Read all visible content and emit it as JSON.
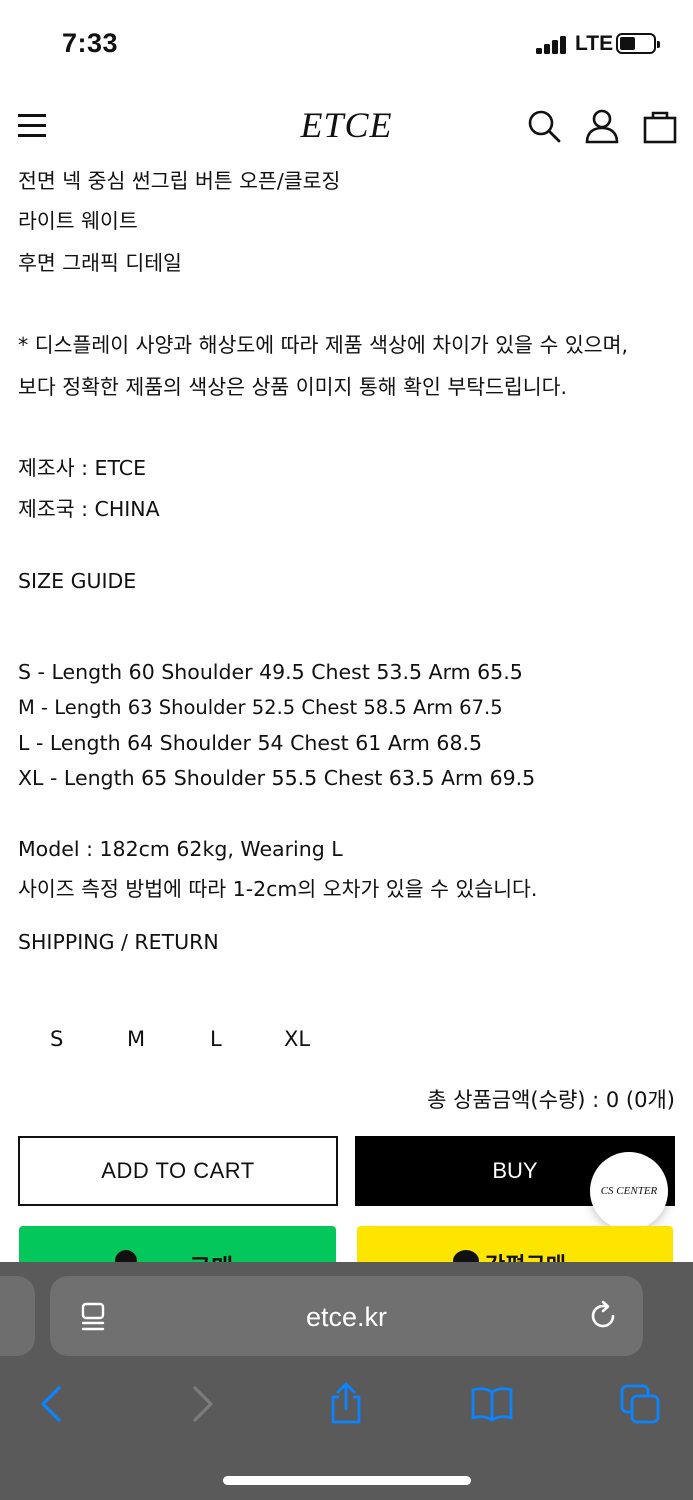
{
  "status_bar": {
    "time": "7:33",
    "network": "LTE"
  },
  "header": {
    "logo": "ETCE"
  },
  "description": {
    "lines": [
      "전면 넥 중심 썬그립 버튼 오픈/클로징",
      "라이트 웨이트",
      "후면 그래픽 디테일",
      "* 디스플레이 사양과 해상도에 따라 제품 색상에 차이가 있을 수 있으며,",
      "보다 정확한 제품의 색상은 상품 이미지 통해 확인 부탁드립니다.",
      "제조사 : ETCE",
      "제조국 : CHINA",
      "SIZE GUIDE",
      "S - Length 60 Shoulder 49.5 Chest 53.5 Arm 65.5",
      "M - Length 63 Shoulder 52.5 Chest 58.5 Arm 67.5",
      "L - Length 64 Shoulder 54 Chest 61 Arm 68.5",
      "XL - Length 65 Shoulder 55.5 Chest 63.5 Arm 69.5",
      "Model : 182cm 62kg, Wearing L",
      "사이즈 측정 방법에 따라 1-2cm의 오차가 있을 수 있습니다.",
      "SHIPPING / RETURN"
    ]
  },
  "sizes": [
    "S",
    "M",
    "L",
    "XL"
  ],
  "total": "총 상품금액(수량) : 0 (0개)",
  "buttons": {
    "add_to_cart": "ADD TO CART",
    "buy": "BUY",
    "cs_center": "CS CENTER",
    "npay": "pay 구매",
    "kakao_pay": "간편구매"
  },
  "browser": {
    "url": "etce.kr"
  },
  "colors": {
    "npay_green": "#03c75a",
    "kakao_yellow": "#fee500",
    "safari_blue": "#0a84ff"
  }
}
